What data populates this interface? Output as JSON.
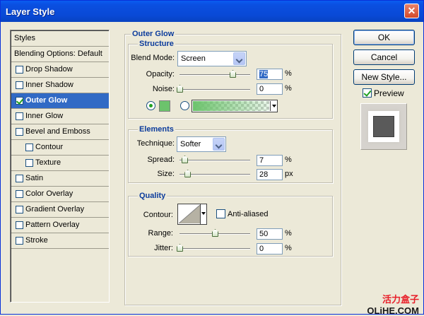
{
  "window": {
    "title": "Layer Style",
    "close_glyph": "✕"
  },
  "styles_list": {
    "items": [
      {
        "label": "Styles",
        "type": "header",
        "checked": false,
        "selected": false,
        "indent": 0
      },
      {
        "label": "Blending Options: Default",
        "type": "header",
        "checked": false,
        "selected": false,
        "indent": 0
      },
      {
        "label": "Drop Shadow",
        "type": "option",
        "checked": false,
        "selected": false,
        "indent": 0
      },
      {
        "label": "Inner Shadow",
        "type": "option",
        "checked": false,
        "selected": false,
        "indent": 0
      },
      {
        "label": "Outer Glow",
        "type": "option",
        "checked": true,
        "selected": true,
        "indent": 0
      },
      {
        "label": "Inner Glow",
        "type": "option",
        "checked": false,
        "selected": false,
        "indent": 0
      },
      {
        "label": "Bevel and Emboss",
        "type": "option",
        "checked": false,
        "selected": false,
        "indent": 0
      },
      {
        "label": "Contour",
        "type": "option",
        "checked": false,
        "selected": false,
        "indent": 1
      },
      {
        "label": "Texture",
        "type": "option",
        "checked": false,
        "selected": false,
        "indent": 1
      },
      {
        "label": "Satin",
        "type": "option",
        "checked": false,
        "selected": false,
        "indent": 0
      },
      {
        "label": "Color Overlay",
        "type": "option",
        "checked": false,
        "selected": false,
        "indent": 0
      },
      {
        "label": "Gradient Overlay",
        "type": "option",
        "checked": false,
        "selected": false,
        "indent": 0
      },
      {
        "label": "Pattern Overlay",
        "type": "option",
        "checked": false,
        "selected": false,
        "indent": 0
      },
      {
        "label": "Stroke",
        "type": "option",
        "checked": false,
        "selected": false,
        "indent": 0
      }
    ]
  },
  "outer_glow": {
    "title": "Outer Glow",
    "structure": {
      "title": "Structure",
      "blend_mode_label": "Blend Mode:",
      "blend_mode_value": "Screen",
      "opacity_label": "Opacity:",
      "opacity_value": "75",
      "opacity_unit": "%",
      "opacity_level": 0.75,
      "noise_label": "Noise:",
      "noise_value": "0",
      "noise_unit": "%",
      "noise_level": 0,
      "color_mode": "solid",
      "glow_color": "#6cc36c",
      "gradient_from": "#6cc36c"
    },
    "elements": {
      "title": "Elements",
      "technique_label": "Technique:",
      "technique_value": "Softer",
      "spread_label": "Spread:",
      "spread_value": "7",
      "spread_unit": "%",
      "spread_level": 0.07,
      "size_label": "Size:",
      "size_value": "28",
      "size_unit": "px",
      "size_level": 0.112
    },
    "quality": {
      "title": "Quality",
      "contour_label": "Contour:",
      "anti_aliased_label": "Anti-aliased",
      "anti_aliased_checked": false,
      "range_label": "Range:",
      "range_value": "50",
      "range_unit": "%",
      "range_level": 0.5,
      "jitter_label": "Jitter:",
      "jitter_value": "0",
      "jitter_unit": "%",
      "jitter_level": 0
    }
  },
  "buttons": {
    "ok": "OK",
    "cancel": "Cancel",
    "new_style": "New Style..."
  },
  "preview": {
    "label": "Preview",
    "checked": true
  },
  "watermark": {
    "line1": "活力盒子",
    "line2": "OLiHE.COM"
  }
}
